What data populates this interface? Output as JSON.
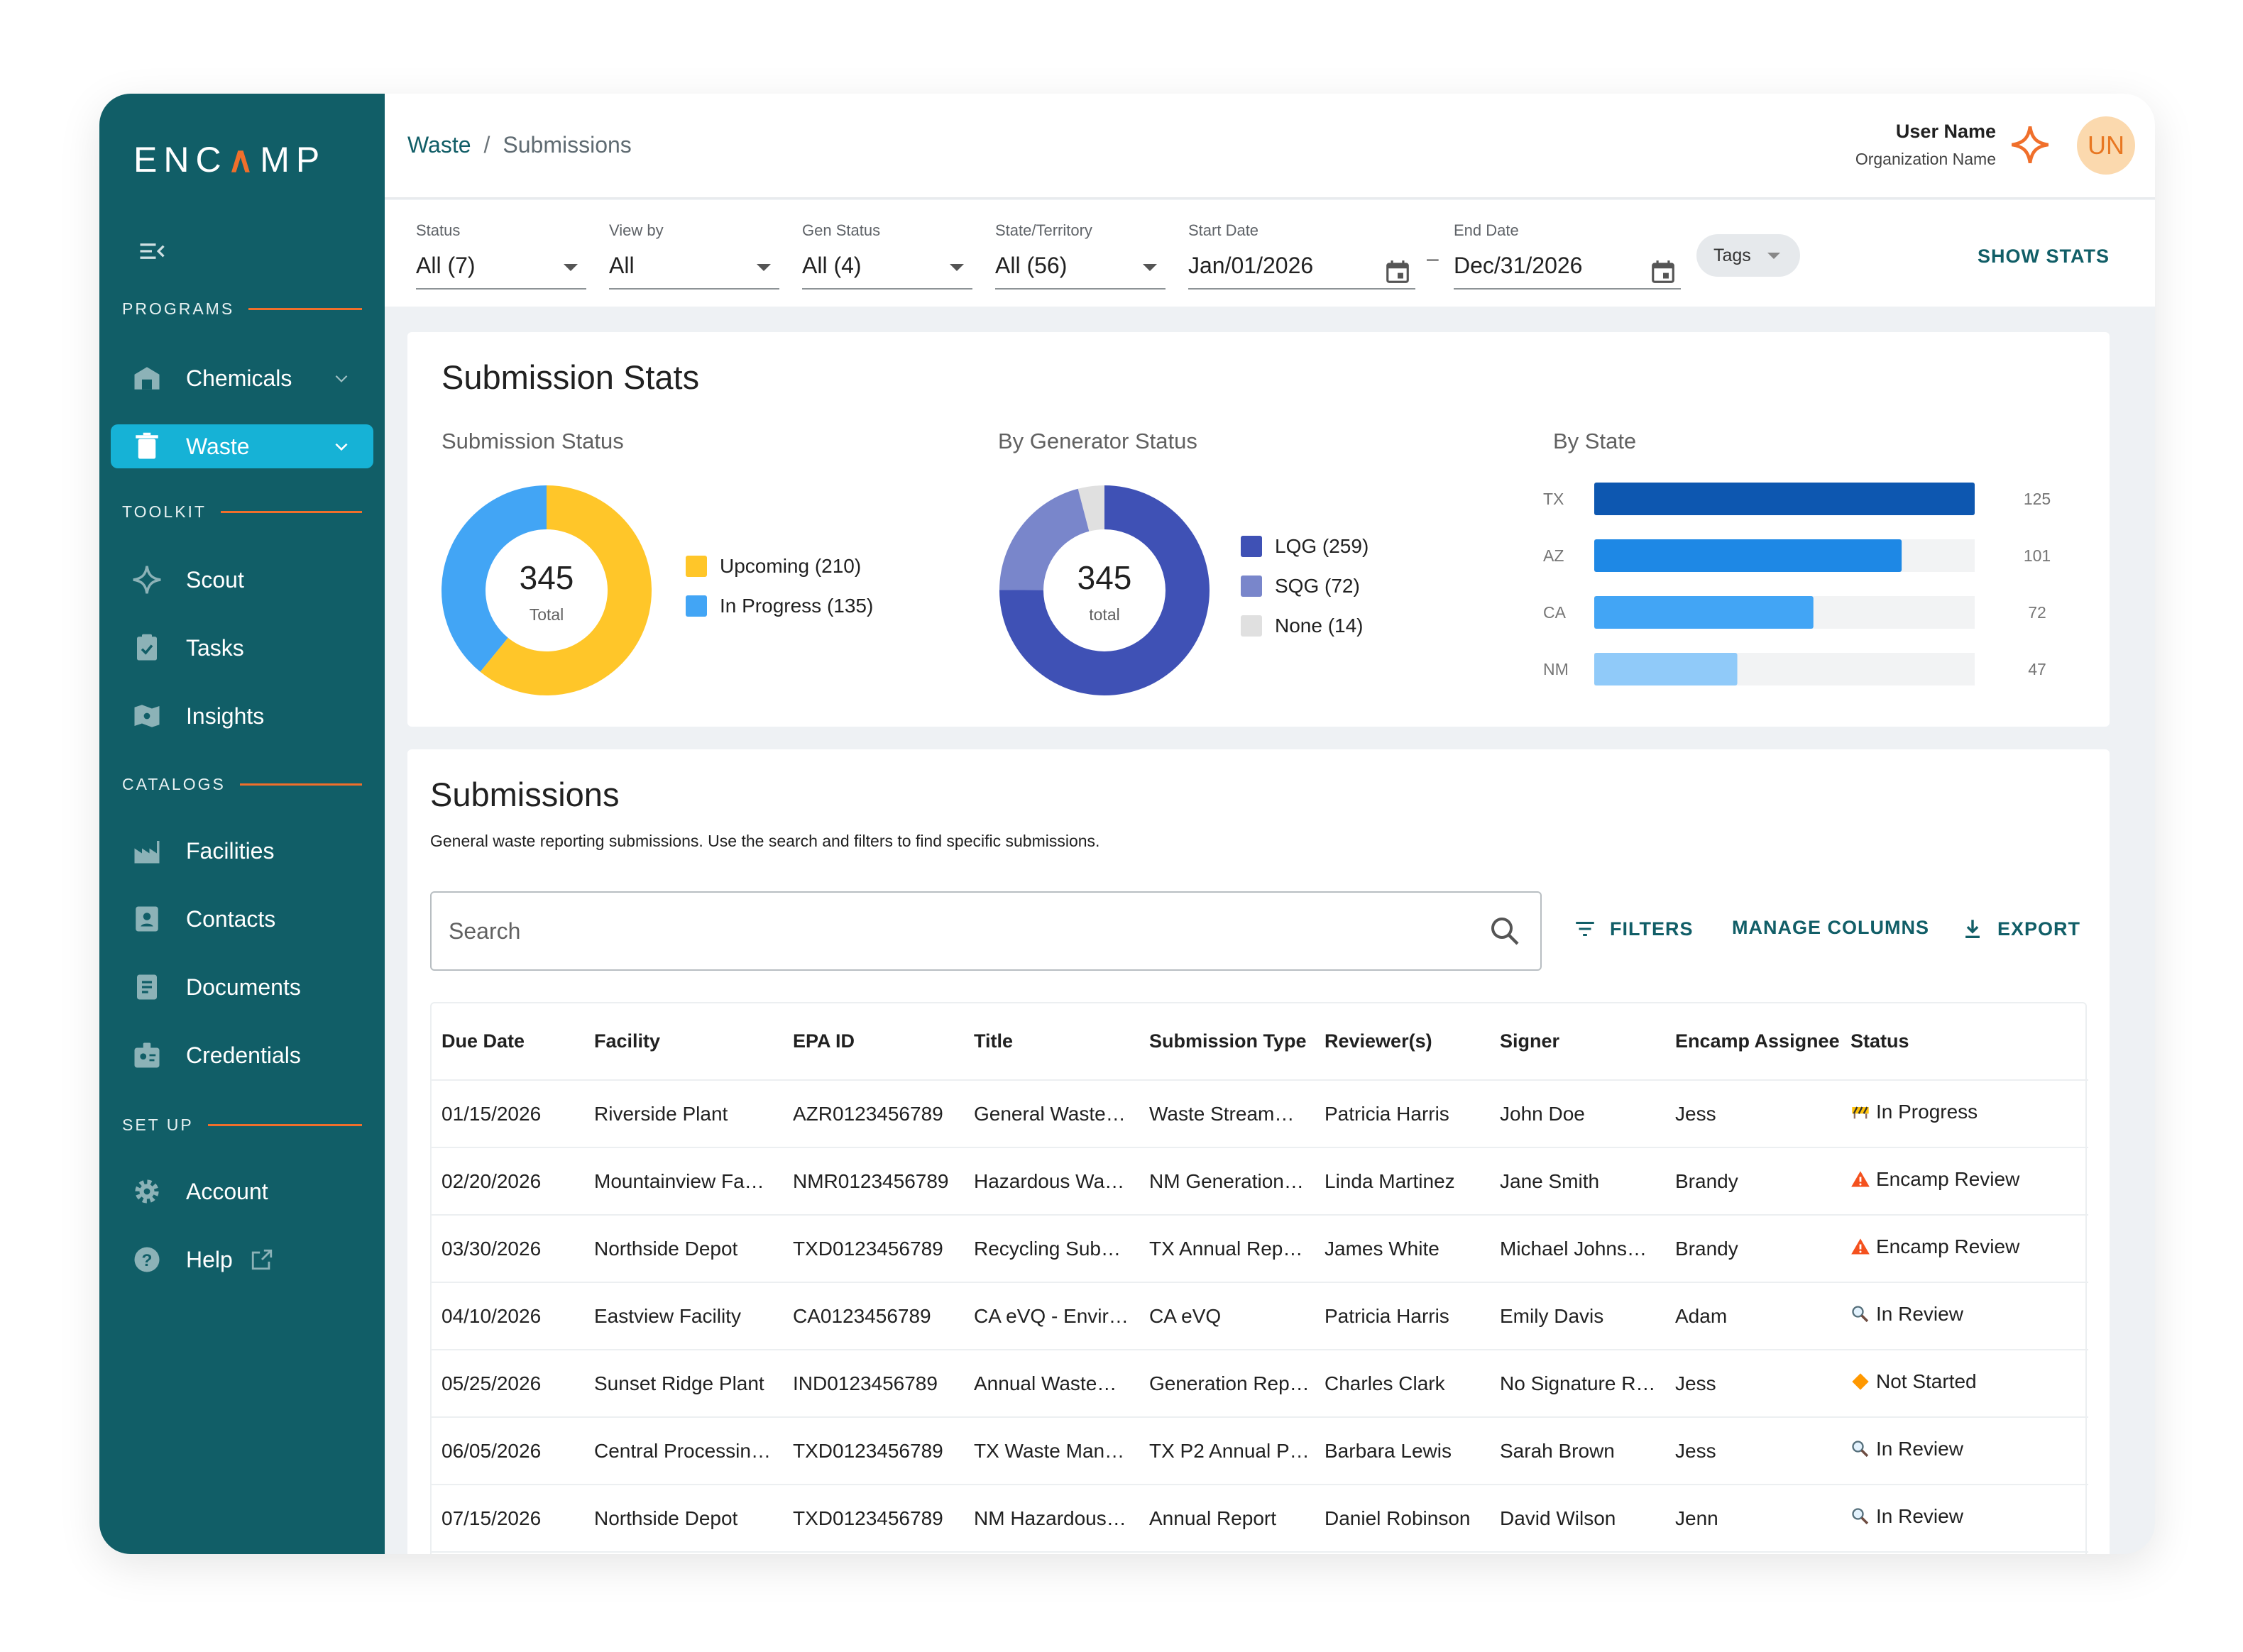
{
  "brand": {
    "logo_pre": "ENC",
    "logo_a": "∧",
    "logo_post": "MP"
  },
  "sidebar": {
    "sections": {
      "programs": "PROGRAMS",
      "toolkit": "TOOLKIT",
      "catalogs": "CATALOGS",
      "setup": "SET UP"
    },
    "items": [
      {
        "label": "Chemicals",
        "icon": "warehouse-icon"
      },
      {
        "label": "Waste",
        "icon": "trash-icon",
        "active": true
      },
      {
        "label": "Scout",
        "icon": "sparkle-icon"
      },
      {
        "label": "Tasks",
        "icon": "clipboard-icon"
      },
      {
        "label": "Insights",
        "icon": "map-icon"
      },
      {
        "label": "Facilities",
        "icon": "factory-icon"
      },
      {
        "label": "Contacts",
        "icon": "contact-card-icon"
      },
      {
        "label": "Documents",
        "icon": "document-icon"
      },
      {
        "label": "Credentials",
        "icon": "badge-icon"
      },
      {
        "label": "Account",
        "icon": "gear-icon"
      },
      {
        "label": "Help",
        "icon": "help-icon"
      }
    ]
  },
  "header": {
    "breadcrumb": [
      "Waste",
      "Submissions"
    ],
    "user_name": "User Name",
    "org_name": "Organization Name",
    "avatar": "UN"
  },
  "filters": {
    "status": {
      "label": "Status",
      "value": "All (7)"
    },
    "view_by": {
      "label": "View by",
      "value": "All"
    },
    "gen_status": {
      "label": "Gen Status",
      "value": "All (4)"
    },
    "state": {
      "label": "State/Territory",
      "value": "All (56)"
    },
    "start_date": {
      "label": "Start Date",
      "value": "Jan/01/2026"
    },
    "end_date": {
      "label": "End Date",
      "value": "Dec/31/2026"
    },
    "dash": "–",
    "tags": "Tags",
    "show_stats": "SHOW STATS"
  },
  "stats": {
    "title": "Submission Stats",
    "submission_status": {
      "title": "Submission Status",
      "total": "345",
      "total_label": "Total",
      "legend": [
        {
          "label": "Upcoming (210)",
          "value": 210,
          "color": "#ffc629"
        },
        {
          "label": "In Progress (135)",
          "value": 135,
          "color": "#42a5f5"
        }
      ]
    },
    "generator_status": {
      "title": "By Generator Status",
      "total": "345",
      "total_label": "total",
      "legend": [
        {
          "label": "LQG (259)",
          "value": 259,
          "color": "#3f51b5"
        },
        {
          "label": "SQG (72)",
          "value": 72,
          "color": "#7986cb"
        },
        {
          "label": "None (14)",
          "value": 14,
          "color": "#e0e0e0"
        }
      ]
    },
    "by_state_title": "By State"
  },
  "chart_data": {
    "type": "bar",
    "orientation": "horizontal",
    "title": "By State",
    "categories": [
      "TX",
      "AZ",
      "CA",
      "NM"
    ],
    "values": [
      125,
      101,
      72,
      47
    ],
    "colors": [
      "#0d57b0",
      "#1e88e5",
      "#42a5f5",
      "#90caf9"
    ],
    "xlim": [
      0,
      125
    ]
  },
  "submissions": {
    "title": "Submissions",
    "description": "General waste reporting submissions. Use the search and filters to find specific submissions.",
    "search_placeholder": "Search",
    "filters_btn": "FILTERS",
    "manage_columns_btn": "MANAGE COLUMNS",
    "export_btn": "EXPORT",
    "columns": [
      "Due Date",
      "Facility",
      "EPA ID",
      "Title",
      "Submission Type",
      "Reviewer(s)",
      "Signer",
      "Encamp Assignee",
      "Status"
    ],
    "rows": [
      [
        "01/15/2026",
        "Riverside Plant",
        "AZR0123456789",
        "General Waste…",
        "Waste Stream…",
        "Patricia Harris",
        "John Doe",
        "Jess",
        "In Progress",
        "barrier"
      ],
      [
        "02/20/2026",
        "Mountainview Fa…",
        "NMR0123456789",
        "Hazardous Wa…",
        "NM Generation…",
        "Linda Martinez",
        "Jane Smith",
        "Brandy",
        "Encamp Review",
        "warning"
      ],
      [
        "03/30/2026",
        "Northside Depot",
        "TXD0123456789",
        "Recycling Sub…",
        "TX Annual Rep…",
        "James White",
        "Michael Johns…",
        "Brandy",
        "Encamp Review",
        "warning"
      ],
      [
        "04/10/2026",
        "Eastview Facility",
        "CA0123456789",
        "CA eVQ - Envir…",
        "CA eVQ",
        "Patricia Harris",
        "Emily Davis",
        "Adam",
        "In Review",
        "magnifier"
      ],
      [
        "05/25/2026",
        "Sunset Ridge Plant",
        "IND0123456789",
        "Annual Waste…",
        "Generation Rep…",
        "Charles Clark",
        "No Signature R…",
        "Jess",
        "Not Started",
        "diamond"
      ],
      [
        "06/05/2026",
        "Central Processin…",
        "TXD0123456789",
        "TX Waste Man…",
        "TX P2 Annual P…",
        "Barbara Lewis",
        "Sarah Brown",
        "Jess",
        "In Review",
        "magnifier"
      ],
      [
        "07/15/2026",
        "Northside Depot",
        "TXD0123456789",
        "NM Hazardous…",
        "Annual Report",
        "Daniel Robinson",
        "David Wilson",
        "Jenn",
        "In Review",
        "magnifier"
      ]
    ]
  }
}
